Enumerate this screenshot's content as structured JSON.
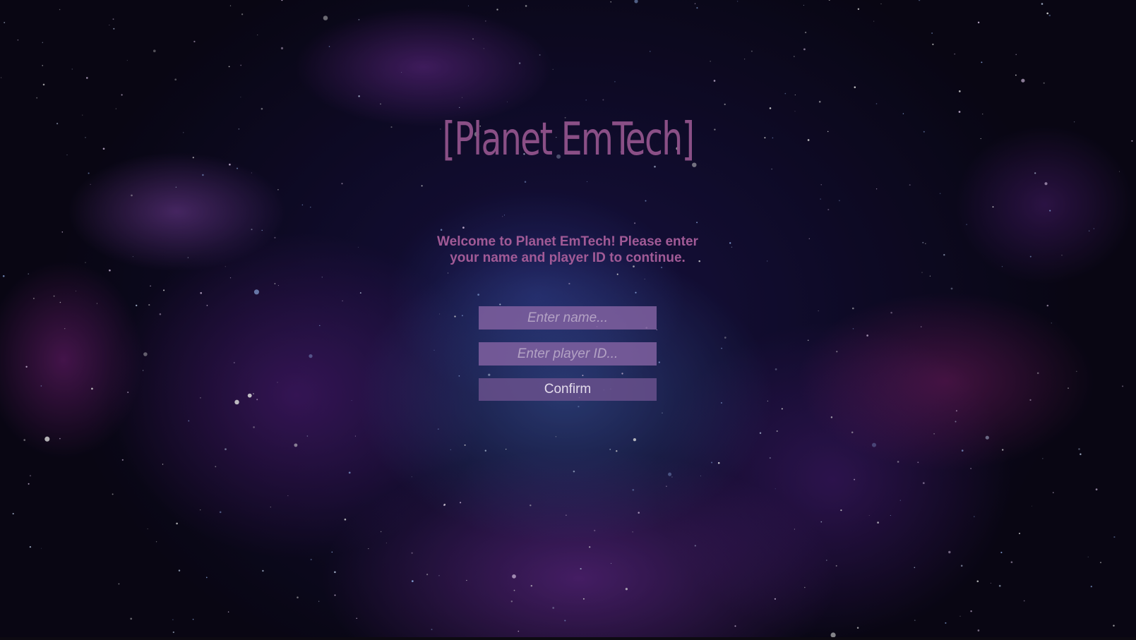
{
  "title": "[Planet EmTech]",
  "welcome_line_1": "Welcome to Planet EmTech! Please enter",
  "welcome_line_2": "your name and player ID to continue.",
  "form": {
    "name_placeholder": "Enter name...",
    "player_id_placeholder": "Enter player ID...",
    "confirm_label": "Confirm"
  },
  "colors": {
    "title": "#8a4f86",
    "welcome_text": "#a15a96",
    "input_background": "#8060a0",
    "button_background": "#69508c"
  }
}
